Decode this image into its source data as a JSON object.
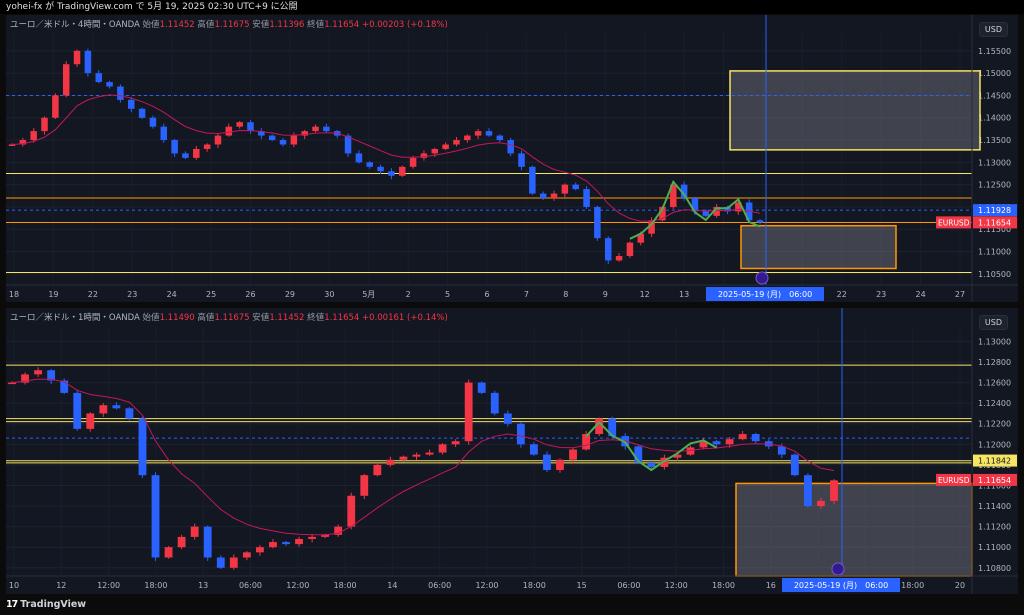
{
  "header": {
    "title": "yohei-fx が TradingView.com で 5月 19, 2025 02:30 UTC+9 に公開"
  },
  "footer": {
    "logo_text": "TradingView"
  },
  "colors": {
    "bull": "#f23645",
    "bear": "#2962ff",
    "ma": "#c2185b",
    "yellow_line": "#f7e463",
    "orange_line": "#ff9800",
    "green_wave": "#4caf50",
    "price_tag": "#f23645",
    "date_tag": "#2962ff",
    "box_fill": "#787b86"
  },
  "panels": [
    {
      "id": "p1",
      "legend": {
        "symbol": "ユーロ／米ドル・4時間・OANDA",
        "open_label": "始値",
        "open": "1.11452",
        "high_label": "高値",
        "high": "1.11675",
        "low_label": "安値",
        "low": "1.11396",
        "close_label": "終値",
        "close": "1.11654",
        "change": "+0.00203 (+0.18%)"
      },
      "currency": "USD",
      "y_ticks": [
        "1.15500",
        "1.15000",
        "1.14500",
        "1.14000",
        "1.13500",
        "1.13000",
        "1.12500",
        "1.12000",
        "1.11500",
        "1.11000",
        "1.10500"
      ],
      "x_ticks": [
        "18",
        "19",
        "22",
        "23",
        "24",
        "25",
        "26",
        "29",
        "30",
        "5月",
        "2",
        "5",
        "6",
        "7",
        "8",
        "9",
        "12",
        "13",
        "14",
        "15",
        "21",
        "22",
        "23",
        "24",
        "27"
      ],
      "date_tag": "2025-05-19 (月)　06:00",
      "price_tags": [
        {
          "value": "1.11928",
          "kind": "blue"
        },
        {
          "symbol": "EURUSD",
          "value": "1.11654",
          "kind": "red"
        }
      ]
    },
    {
      "id": "p2",
      "legend": {
        "symbol": "ユーロ／米ドル・1時間・OANDA",
        "open_label": "始値",
        "open": "1.11490",
        "high_label": "高値",
        "high": "1.11675",
        "low_label": "安値",
        "low": "1.11452",
        "close_label": "終値",
        "close": "1.11654",
        "change": "+0.00161 (+0.14%)"
      },
      "currency": "USD",
      "y_ticks": [
        "1.13000",
        "1.12800",
        "1.12600",
        "1.12400",
        "1.12200",
        "1.12000",
        "1.11800",
        "1.11600",
        "1.11400",
        "1.11200",
        "1.11000",
        "1.10800"
      ],
      "x_ticks": [
        "10",
        "12",
        "12:00",
        "18:00",
        "13",
        "06:00",
        "12:00",
        "18:00",
        "14",
        "06:00",
        "12:00",
        "18:00",
        "15",
        "06:00",
        "12:00",
        "18:00",
        "16",
        "06:00",
        "12:00",
        "18:00",
        "20"
      ],
      "date_tag": "2025-05-19 (月)　06:00",
      "price_tags": [
        {
          "value": "1.11842",
          "kind": "yellow"
        },
        {
          "symbol": "EURUSD",
          "value": "1.11654",
          "kind": "red"
        }
      ]
    }
  ],
  "chart_data": [
    {
      "type": "candlestick",
      "title": "ユーロ／米ドル・4時間・OANDA",
      "ylim": [
        1.1025,
        1.159
      ],
      "current_price": 1.11654,
      "lines": {
        "yellow": [
          1.1275,
          1.1053
        ],
        "orange": [
          1.122,
          1.1165
        ],
        "blue_dashed": [
          1.145,
          1.1193
        ]
      },
      "zones": [
        {
          "name": "upper",
          "from": 1.1328,
          "to": 1.1505
        },
        {
          "name": "lower",
          "from": 1.1062,
          "to": 1.1158
        }
      ],
      "close_path": [
        1.134,
        1.135,
        1.137,
        1.14,
        1.145,
        1.152,
        1.155,
        1.15,
        1.148,
        1.147,
        1.144,
        1.142,
        1.14,
        1.138,
        1.135,
        1.132,
        1.131,
        1.133,
        1.134,
        1.136,
        1.138,
        1.139,
        1.137,
        1.136,
        1.135,
        1.134,
        1.136,
        1.137,
        1.138,
        1.137,
        1.136,
        1.132,
        1.13,
        1.129,
        1.128,
        1.127,
        1.129,
        1.131,
        1.132,
        1.133,
        1.134,
        1.135,
        1.136,
        1.137,
        1.136,
        1.135,
        1.132,
        1.129,
        1.123,
        1.122,
        1.123,
        1.125,
        1.124,
        1.12,
        1.113,
        1.108,
        1.109,
        1.112,
        1.114,
        1.117,
        1.12,
        1.125,
        1.122,
        1.119,
        1.118,
        1.12,
        1.119,
        1.121,
        1.117,
        1.1165
      ]
    },
    {
      "type": "candlestick",
      "title": "ユーロ／米ドル・1時間・OANDA",
      "ylim": [
        1.1072,
        1.1315
      ],
      "current_price": 1.11654,
      "lines": {
        "yellow": [
          1.1277,
          1.1225,
          1.1222,
          1.1182,
          1.1184
        ],
        "blue_dashed": [
          1.1206
        ]
      },
      "zones": [
        {
          "name": "lower",
          "from": 1.1072,
          "to": 1.1162
        }
      ],
      "close_path": [
        1.126,
        1.1268,
        1.1272,
        1.1262,
        1.125,
        1.1215,
        1.123,
        1.1238,
        1.1235,
        1.1225,
        1.117,
        1.109,
        1.11,
        1.111,
        1.112,
        1.109,
        1.108,
        1.109,
        1.1095,
        1.11,
        1.1105,
        1.1103,
        1.1108,
        1.111,
        1.1112,
        1.112,
        1.115,
        1.117,
        1.118,
        1.1185,
        1.1188,
        1.119,
        1.1192,
        1.12,
        1.1203,
        1.126,
        1.125,
        1.123,
        1.122,
        1.12,
        1.119,
        1.1175,
        1.1185,
        1.1195,
        1.121,
        1.1225,
        1.1208,
        1.1198,
        1.1182,
        1.1178,
        1.1187,
        1.119,
        1.1197,
        1.1203,
        1.12,
        1.1205,
        1.121,
        1.1203,
        1.1198,
        1.119,
        1.117,
        1.114,
        1.1145,
        1.1165
      ]
    }
  ]
}
